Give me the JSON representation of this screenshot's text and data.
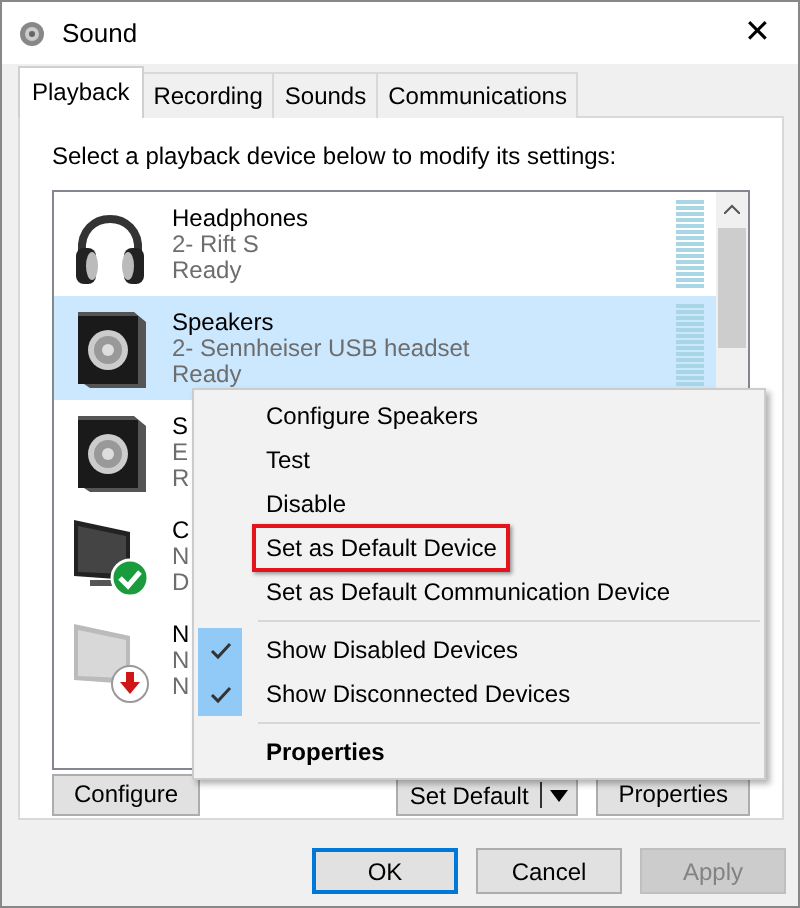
{
  "window": {
    "title": "Sound",
    "close": "✕"
  },
  "tabs": [
    {
      "label": "Playback",
      "selected": true
    },
    {
      "label": "Recording",
      "selected": false
    },
    {
      "label": "Sounds",
      "selected": false
    },
    {
      "label": "Communications",
      "selected": false
    }
  ],
  "instruction": "Select a playback device below to modify its settings:",
  "devices": [
    {
      "kind": "headphones",
      "name": "Headphones",
      "description": "2- Rift S",
      "status": "Ready",
      "selected": false
    },
    {
      "kind": "speaker",
      "name": "Speakers",
      "description": "2- Sennheiser USB headset",
      "status": "Ready",
      "selected": true
    },
    {
      "kind": "speaker",
      "name": "S",
      "description": "E",
      "status": "R",
      "selected": false
    },
    {
      "kind": "monitor-default",
      "name": "C",
      "description": "N",
      "status": "D",
      "selected": false
    },
    {
      "kind": "monitor-disconnected",
      "name": "N",
      "description": "N",
      "status": "N",
      "selected": false
    }
  ],
  "context_menu": [
    [
      {
        "label": "Configure Speakers",
        "checked": false,
        "bold": false,
        "outlined": false
      },
      {
        "label": "Test",
        "checked": false,
        "bold": false,
        "outlined": false
      },
      {
        "label": "Disable",
        "checked": false,
        "bold": false,
        "outlined": false
      },
      {
        "label": "Set as Default Device",
        "checked": false,
        "bold": false,
        "outlined": true
      },
      {
        "label": "Set as Default Communication Device",
        "checked": false,
        "bold": false,
        "outlined": false
      }
    ],
    [
      {
        "label": "Show Disabled Devices",
        "checked": true,
        "bold": false,
        "outlined": false
      },
      {
        "label": "Show Disconnected Devices",
        "checked": true,
        "bold": false,
        "outlined": false
      }
    ],
    [
      {
        "label": "Properties",
        "checked": false,
        "bold": true,
        "outlined": false
      }
    ]
  ],
  "panel_buttons": {
    "configure": "Configure",
    "set_default": "Set Default",
    "properties": "Properties"
  },
  "dialog_buttons": [
    {
      "label": "OK",
      "default": true,
      "disabled": false
    },
    {
      "label": "Cancel",
      "default": false,
      "disabled": false
    },
    {
      "label": "Apply",
      "default": false,
      "disabled": true
    }
  ]
}
